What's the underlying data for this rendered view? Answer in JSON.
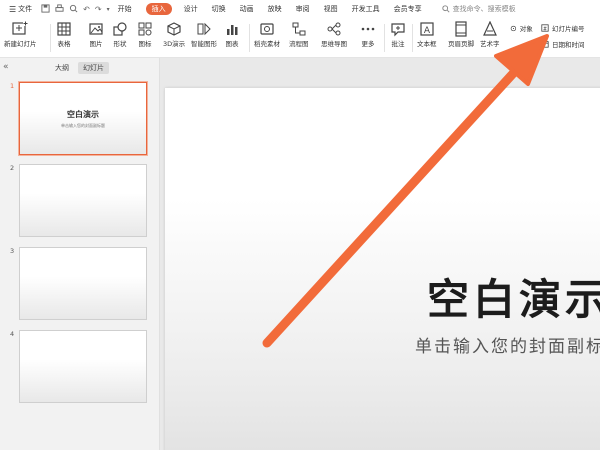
{
  "menubar": {
    "file_label": "文件",
    "tabs": [
      "开始",
      "插入",
      "设计",
      "切换",
      "动画",
      "放映",
      "审阅",
      "视图",
      "开发工具",
      "会员专享"
    ],
    "active_tab": "插入",
    "search_placeholder": "查找命令、搜索模板"
  },
  "ribbon": {
    "new_slide": "新建幻灯片",
    "table": "表格",
    "picture": "图片",
    "shape": "形状",
    "icon": "图标",
    "demo3d": "3D演示",
    "smart_graphic": "智能图形",
    "chart": "图表",
    "material": "稻壳素材",
    "flowchart": "流程图",
    "mindmap": "思维导图",
    "more": "更多",
    "comment": "批注",
    "textbox": "文本框",
    "header_footer": "页眉页脚",
    "art_text": "艺术字",
    "object": "对象",
    "slide_number": "幻灯片编号",
    "date_time": "日期和时间"
  },
  "left_panel": {
    "tab_outline": "大纲",
    "tab_slides": "幻灯片",
    "slides": [
      {
        "num": "1",
        "title": "空白演示",
        "subtitle": "单击输入您的封面副标题"
      },
      {
        "num": "2"
      },
      {
        "num": "3"
      },
      {
        "num": "4"
      }
    ]
  },
  "slide": {
    "title": "空白演示",
    "subtitle": "单击输入您的封面副标题"
  },
  "colors": {
    "accent": "#e8663d",
    "arrow": "#f26b3a"
  }
}
